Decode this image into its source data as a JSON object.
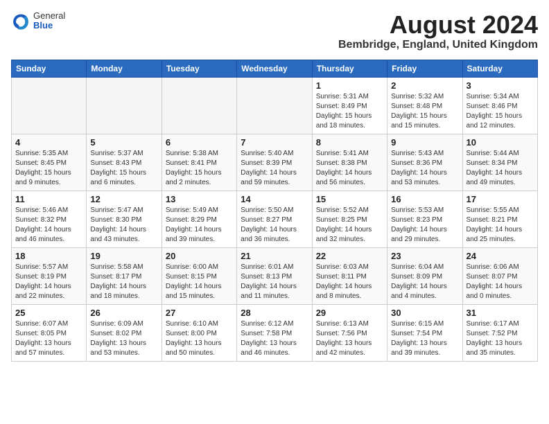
{
  "header": {
    "logo_general": "General",
    "logo_blue": "Blue",
    "month_title": "August 2024",
    "location": "Bembridge, England, United Kingdom"
  },
  "columns": [
    "Sunday",
    "Monday",
    "Tuesday",
    "Wednesday",
    "Thursday",
    "Friday",
    "Saturday"
  ],
  "weeks": [
    [
      {
        "day": "",
        "info": ""
      },
      {
        "day": "",
        "info": ""
      },
      {
        "day": "",
        "info": ""
      },
      {
        "day": "",
        "info": ""
      },
      {
        "day": "1",
        "info": "Sunrise: 5:31 AM\nSunset: 8:49 PM\nDaylight: 15 hours\nand 18 minutes."
      },
      {
        "day": "2",
        "info": "Sunrise: 5:32 AM\nSunset: 8:48 PM\nDaylight: 15 hours\nand 15 minutes."
      },
      {
        "day": "3",
        "info": "Sunrise: 5:34 AM\nSunset: 8:46 PM\nDaylight: 15 hours\nand 12 minutes."
      }
    ],
    [
      {
        "day": "4",
        "info": "Sunrise: 5:35 AM\nSunset: 8:45 PM\nDaylight: 15 hours\nand 9 minutes."
      },
      {
        "day": "5",
        "info": "Sunrise: 5:37 AM\nSunset: 8:43 PM\nDaylight: 15 hours\nand 6 minutes."
      },
      {
        "day": "6",
        "info": "Sunrise: 5:38 AM\nSunset: 8:41 PM\nDaylight: 15 hours\nand 2 minutes."
      },
      {
        "day": "7",
        "info": "Sunrise: 5:40 AM\nSunset: 8:39 PM\nDaylight: 14 hours\nand 59 minutes."
      },
      {
        "day": "8",
        "info": "Sunrise: 5:41 AM\nSunset: 8:38 PM\nDaylight: 14 hours\nand 56 minutes."
      },
      {
        "day": "9",
        "info": "Sunrise: 5:43 AM\nSunset: 8:36 PM\nDaylight: 14 hours\nand 53 minutes."
      },
      {
        "day": "10",
        "info": "Sunrise: 5:44 AM\nSunset: 8:34 PM\nDaylight: 14 hours\nand 49 minutes."
      }
    ],
    [
      {
        "day": "11",
        "info": "Sunrise: 5:46 AM\nSunset: 8:32 PM\nDaylight: 14 hours\nand 46 minutes."
      },
      {
        "day": "12",
        "info": "Sunrise: 5:47 AM\nSunset: 8:30 PM\nDaylight: 14 hours\nand 43 minutes."
      },
      {
        "day": "13",
        "info": "Sunrise: 5:49 AM\nSunset: 8:29 PM\nDaylight: 14 hours\nand 39 minutes."
      },
      {
        "day": "14",
        "info": "Sunrise: 5:50 AM\nSunset: 8:27 PM\nDaylight: 14 hours\nand 36 minutes."
      },
      {
        "day": "15",
        "info": "Sunrise: 5:52 AM\nSunset: 8:25 PM\nDaylight: 14 hours\nand 32 minutes."
      },
      {
        "day": "16",
        "info": "Sunrise: 5:53 AM\nSunset: 8:23 PM\nDaylight: 14 hours\nand 29 minutes."
      },
      {
        "day": "17",
        "info": "Sunrise: 5:55 AM\nSunset: 8:21 PM\nDaylight: 14 hours\nand 25 minutes."
      }
    ],
    [
      {
        "day": "18",
        "info": "Sunrise: 5:57 AM\nSunset: 8:19 PM\nDaylight: 14 hours\nand 22 minutes."
      },
      {
        "day": "19",
        "info": "Sunrise: 5:58 AM\nSunset: 8:17 PM\nDaylight: 14 hours\nand 18 minutes."
      },
      {
        "day": "20",
        "info": "Sunrise: 6:00 AM\nSunset: 8:15 PM\nDaylight: 14 hours\nand 15 minutes."
      },
      {
        "day": "21",
        "info": "Sunrise: 6:01 AM\nSunset: 8:13 PM\nDaylight: 14 hours\nand 11 minutes."
      },
      {
        "day": "22",
        "info": "Sunrise: 6:03 AM\nSunset: 8:11 PM\nDaylight: 14 hours\nand 8 minutes."
      },
      {
        "day": "23",
        "info": "Sunrise: 6:04 AM\nSunset: 8:09 PM\nDaylight: 14 hours\nand 4 minutes."
      },
      {
        "day": "24",
        "info": "Sunrise: 6:06 AM\nSunset: 8:07 PM\nDaylight: 14 hours\nand 0 minutes."
      }
    ],
    [
      {
        "day": "25",
        "info": "Sunrise: 6:07 AM\nSunset: 8:05 PM\nDaylight: 13 hours\nand 57 minutes."
      },
      {
        "day": "26",
        "info": "Sunrise: 6:09 AM\nSunset: 8:02 PM\nDaylight: 13 hours\nand 53 minutes."
      },
      {
        "day": "27",
        "info": "Sunrise: 6:10 AM\nSunset: 8:00 PM\nDaylight: 13 hours\nand 50 minutes."
      },
      {
        "day": "28",
        "info": "Sunrise: 6:12 AM\nSunset: 7:58 PM\nDaylight: 13 hours\nand 46 minutes."
      },
      {
        "day": "29",
        "info": "Sunrise: 6:13 AM\nSunset: 7:56 PM\nDaylight: 13 hours\nand 42 minutes."
      },
      {
        "day": "30",
        "info": "Sunrise: 6:15 AM\nSunset: 7:54 PM\nDaylight: 13 hours\nand 39 minutes."
      },
      {
        "day": "31",
        "info": "Sunrise: 6:17 AM\nSunset: 7:52 PM\nDaylight: 13 hours\nand 35 minutes."
      }
    ]
  ]
}
